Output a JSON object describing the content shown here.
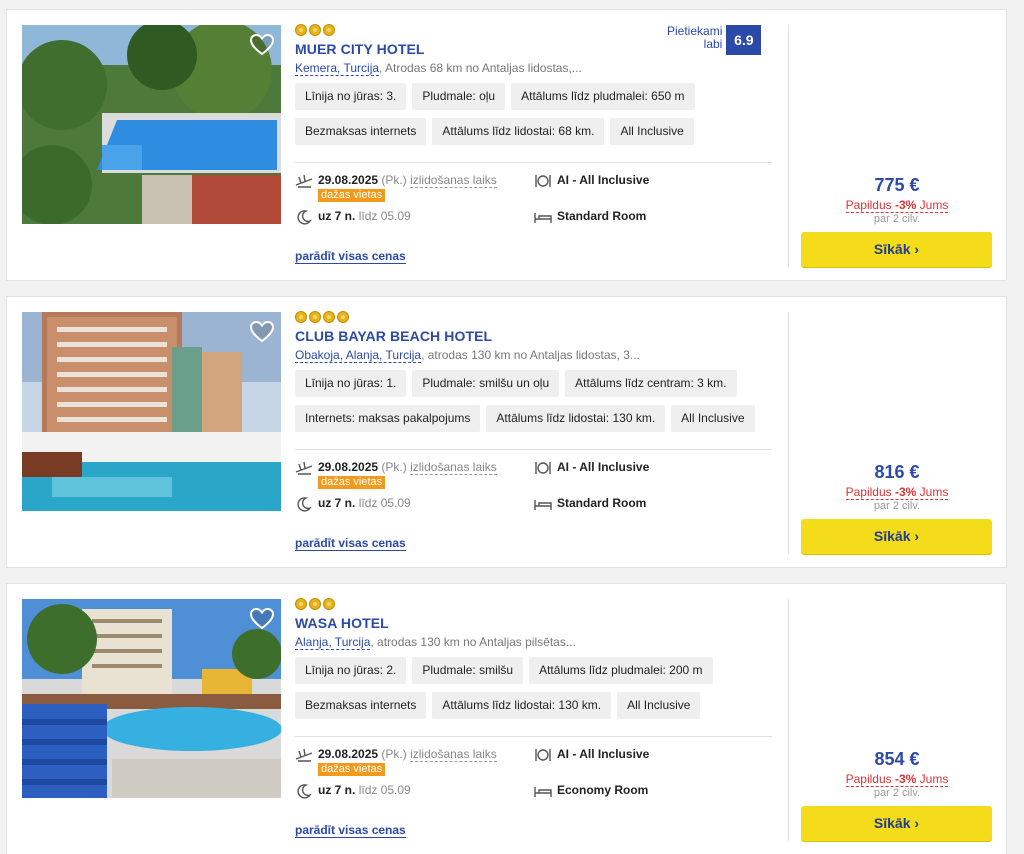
{
  "hotels": [
    {
      "name": "MUER CITY HOTEL",
      "stars": 3,
      "location_link": "Kemera, Turcija",
      "location_rest": ", Atrodas 68 km no Antaljas lidostas,...",
      "rating_label_1": "Pietiekami",
      "rating_label_2": "labi",
      "rating_score": "6.9",
      "tags": [
        "Līnija no jūras: 3.",
        "Pludmale: oļu",
        "Attālums līdz pludmalei: 650 m",
        "Bezmaksas internets",
        "Attālums līdz lidostai: 68 km.",
        "All Inclusive"
      ],
      "date": "29.08.2025",
      "day": "(Pk.)",
      "departure_label": "izlidošanas laiks",
      "badge": "dažas vietas",
      "nights": "uz 7 n.",
      "until": "līdz 05.09",
      "board": "AI - All Inclusive",
      "room": "Standard Room",
      "show_prices": "parādīt visas cenas",
      "price": "775 €",
      "extra_pre": "Papildus ",
      "extra_pct": "-3%",
      "extra_post": " Jums",
      "per_person": "par 2 cilv.",
      "button": "Sīkāk ›"
    },
    {
      "name": "CLUB BAYAR BEACH HOTEL",
      "stars": 4,
      "location_link": "Obakoja, Alanja, Turcija",
      "location_rest": ", atrodas 130 km no Antaljas lidostas, 3...",
      "tags": [
        "Līnija no jūras: 1.",
        "Pludmale: smilšu un oļu",
        "Attālums līdz centram: 3 km.",
        "Internets: maksas pakalpojums",
        "Attālums līdz lidostai: 130 km.",
        "All Inclusive"
      ],
      "date": "29.08.2025",
      "day": "(Pk.)",
      "departure_label": "izlidošanas laiks",
      "badge": "dažas vietas",
      "nights": "uz 7 n.",
      "until": "līdz 05.09",
      "board": "AI - All Inclusive",
      "room": "Standard Room",
      "show_prices": "parādīt visas cenas",
      "price": "816 €",
      "extra_pre": "Papildus ",
      "extra_pct": "-3%",
      "extra_post": " Jums",
      "per_person": "par 2 cilv.",
      "button": "Sīkāk ›"
    },
    {
      "name": "WASA HOTEL",
      "stars": 3,
      "location_link": "Alanja, Turcija",
      "location_rest": ", atrodas 130 km no Antaljas pilsētas...",
      "tags": [
        "Līnija no jūras: 2.",
        "Pludmale: smilšu",
        "Attālums līdz pludmalei: 200 m",
        "Bezmaksas internets",
        "Attālums līdz lidostai: 130 km.",
        "All Inclusive"
      ],
      "date": "29.08.2025",
      "day": "(Pk.)",
      "departure_label": "izlidošanas laiks",
      "badge": "dažas vietas",
      "nights": "uz 7 n.",
      "until": "līdz 05.09",
      "board": "AI - All Inclusive",
      "room": "Economy Room",
      "show_prices": "parādīt visas cenas",
      "price": "854 €",
      "extra_pre": "Papildus ",
      "extra_pct": "-3%",
      "extra_post": " Jums",
      "per_person": "par 2 cilv.",
      "button": "Sīkāk ›"
    }
  ],
  "colors": {
    "accent": "#2b4aa8",
    "button": "#f5dc1a",
    "badge": "#f39a1c",
    "discount": "#d33",
    "star": "#e8b21a"
  },
  "icons": [
    "heart-icon",
    "plane-icon",
    "moon-icon",
    "dining-icon",
    "bed-icon"
  ]
}
